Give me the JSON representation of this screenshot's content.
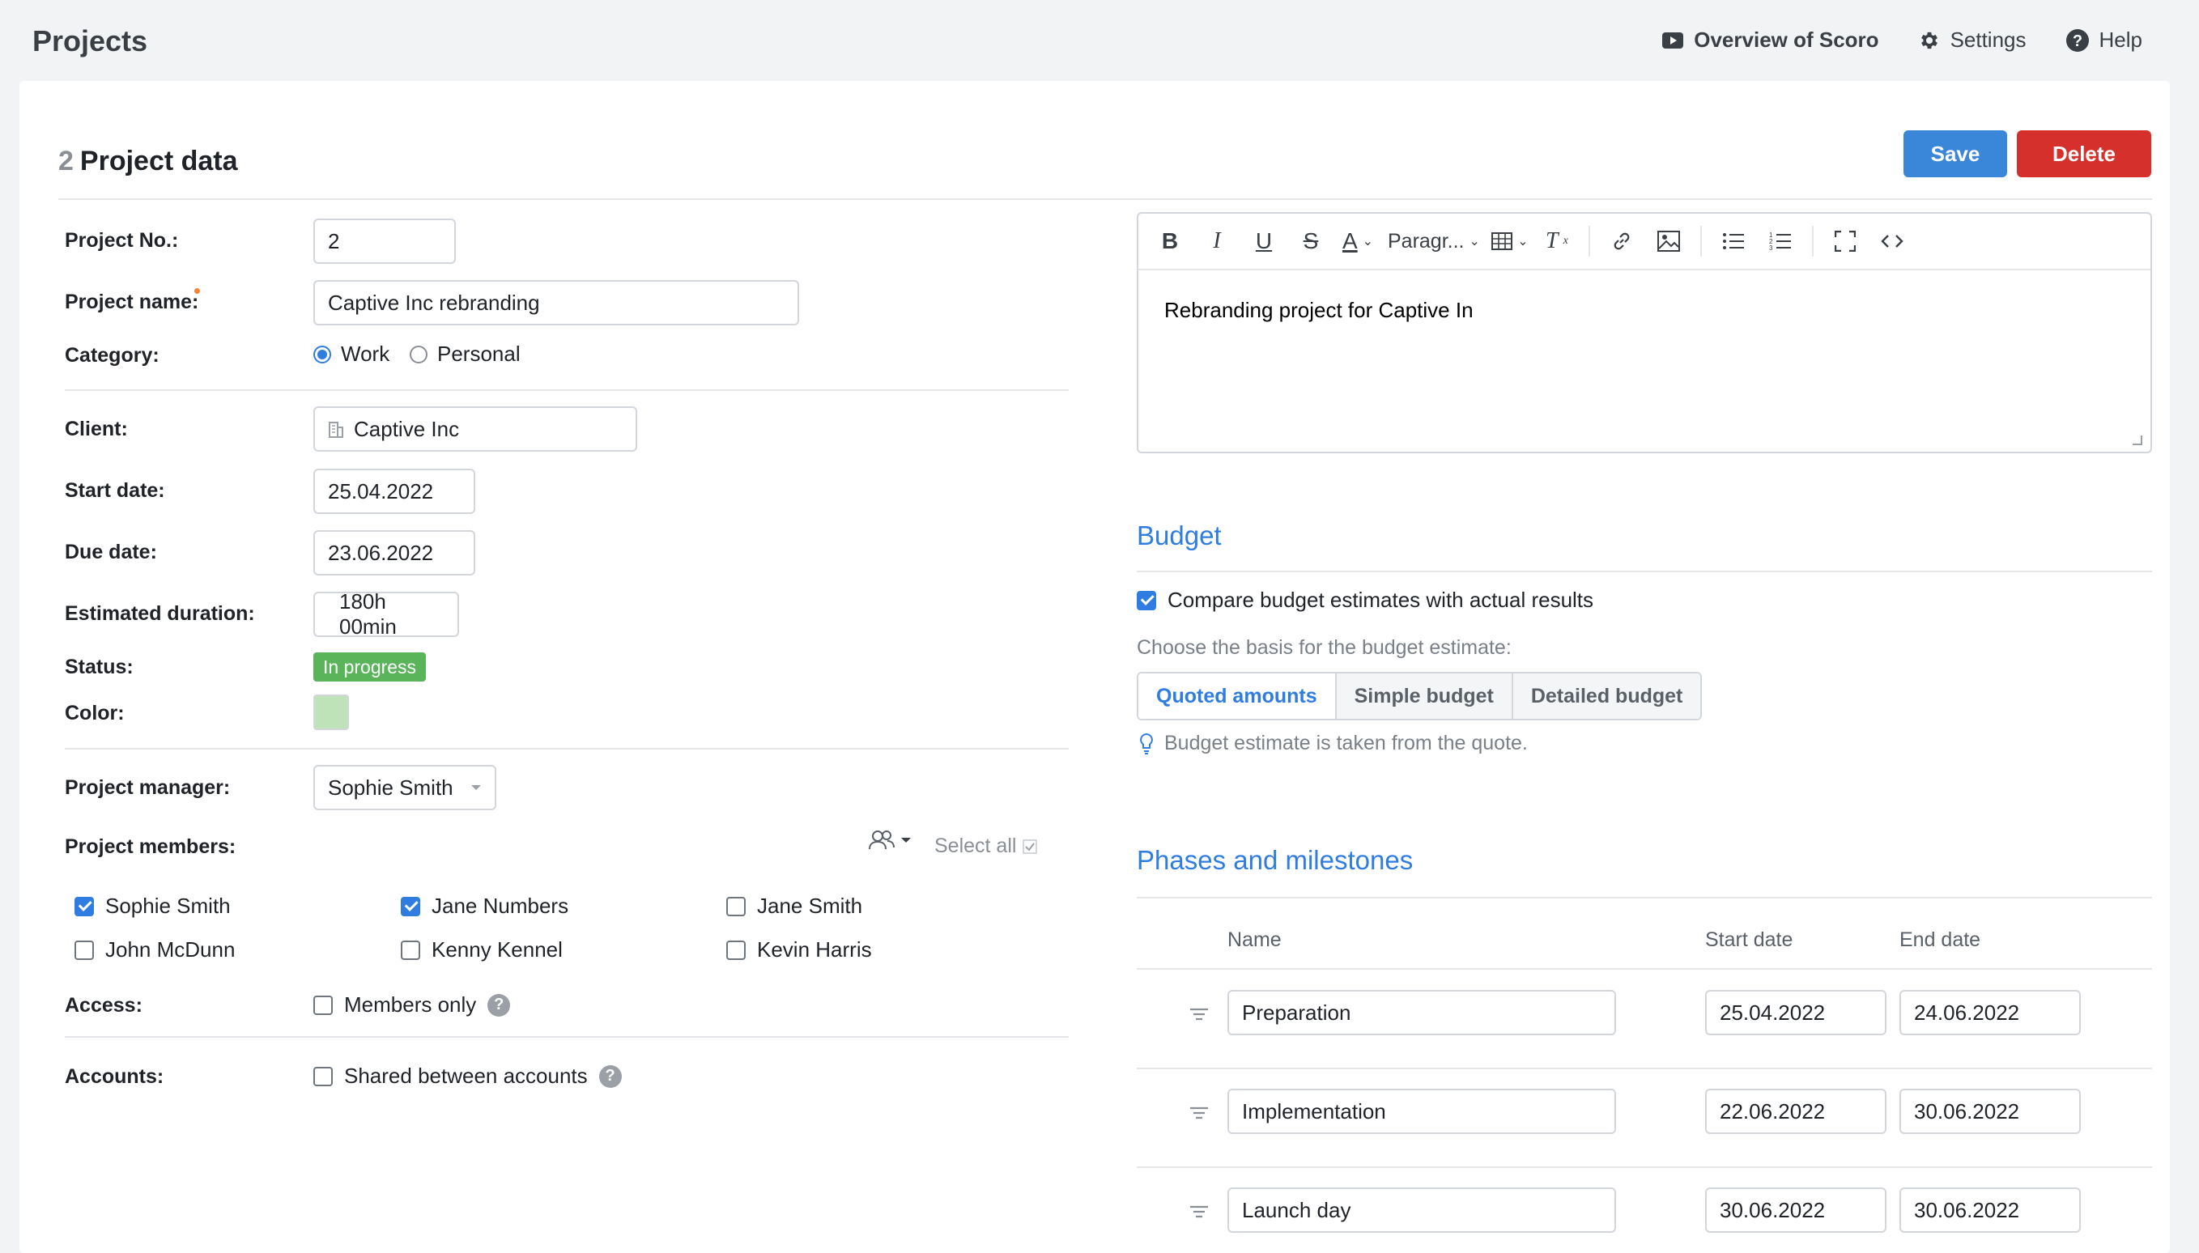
{
  "topbar": {
    "title": "Projects",
    "overview": "Overview of Scoro",
    "settings": "Settings",
    "help": "Help"
  },
  "header": {
    "number": "2",
    "title": "Project data",
    "save_label": "Save",
    "delete_label": "Delete"
  },
  "form": {
    "project_no_label": "Project No.:",
    "project_no": "2",
    "project_name_label": "Project name:",
    "project_name": "Captive Inc rebranding",
    "category_label": "Category:",
    "category_work": "Work",
    "category_personal": "Personal",
    "client_label": "Client:",
    "client": "Captive Inc",
    "start_date_label": "Start date:",
    "start_date": "25.04.2022",
    "due_date_label": "Due date:",
    "due_date": "23.06.2022",
    "duration_label": "Estimated duration:",
    "duration": "180h 00min",
    "status_label": "Status:",
    "status": "In progress",
    "color_label": "Color:",
    "color_value": "#bfe3b8",
    "manager_label": "Project manager:",
    "manager": "Sophie Smith",
    "members_label": "Project members:",
    "select_all": "Select all",
    "members": [
      {
        "name": "Sophie Smith",
        "checked": true
      },
      {
        "name": "Jane Numbers",
        "checked": true
      },
      {
        "name": "Jane Smith",
        "checked": false
      },
      {
        "name": "John McDunn",
        "checked": false
      },
      {
        "name": "Kenny Kennel",
        "checked": false
      },
      {
        "name": "Kevin Harris",
        "checked": false
      }
    ],
    "access_label": "Access:",
    "access_option": "Members only",
    "accounts_label": "Accounts:",
    "accounts_option": "Shared between accounts"
  },
  "editor": {
    "paragraph_label": "Paragr...",
    "content": "Rebranding project for Captive In"
  },
  "budget": {
    "title": "Budget",
    "compare_label": "Compare budget estimates with actual results",
    "basis_prompt": "Choose the basis for the budget estimate:",
    "options": [
      "Quoted amounts",
      "Simple budget",
      "Detailed budget"
    ],
    "hint": "Budget estimate is taken from the quote."
  },
  "phases": {
    "title": "Phases and milestones",
    "col_name": "Name",
    "col_start": "Start date",
    "col_end": "End date",
    "rows": [
      {
        "name": "Preparation",
        "start": "25.04.2022",
        "end": "24.06.2022"
      },
      {
        "name": "Implementation",
        "start": "22.06.2022",
        "end": "30.06.2022"
      },
      {
        "name": "Launch day",
        "start": "30.06.2022",
        "end": "30.06.2022"
      }
    ]
  },
  "colors": {
    "accent": "#2f7de1",
    "save": "#3a87d9",
    "delete": "#d6302c",
    "status_green": "#5ab55a"
  }
}
